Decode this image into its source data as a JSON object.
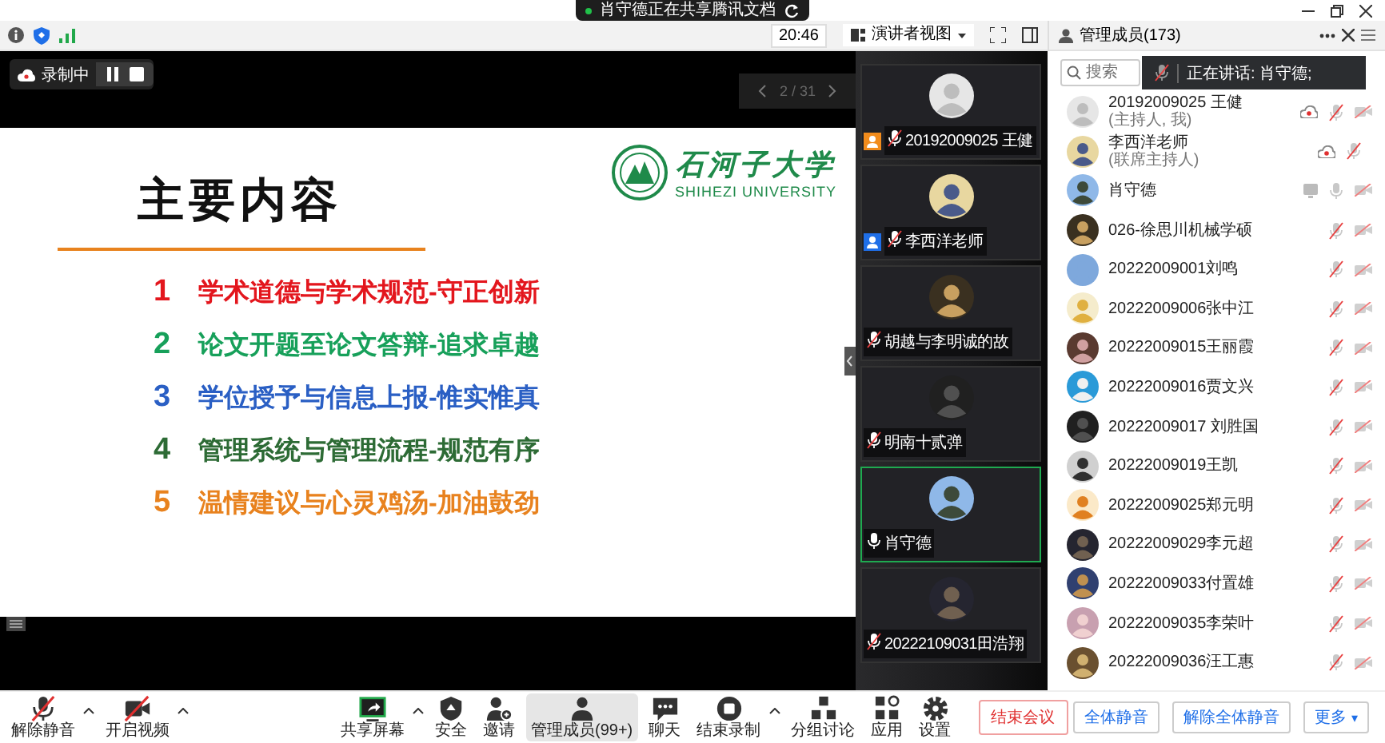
{
  "share_banner": {
    "text": "肖守德正在共享腾讯文档"
  },
  "toolbar": {
    "time": "20:46",
    "view": "演讲者视图",
    "members_title": "管理成员(173)"
  },
  "recording": {
    "label": "录制中"
  },
  "slide": {
    "page": "2 / 31",
    "title": "主要内容",
    "logo_cn": "石河子大学",
    "logo_en": "SHIHEZI UNIVERSITY",
    "items": [
      {
        "number": "1",
        "text": "学术道德与学术规范-守正创新",
        "color": "#e3161d"
      },
      {
        "number": "2",
        "text": "论文开题至论文答辩-追求卓越",
        "color": "#17a05a"
      },
      {
        "number": "3",
        "text": "学位授予与信息上报-惟实惟真",
        "color": "#2a5fc4"
      },
      {
        "number": "4",
        "text": "管理系统与管理流程-规范有序",
        "color": "#2d6b35"
      },
      {
        "number": "5",
        "text": "温情建议与心灵鸡汤-加油鼓劲",
        "color": "#e8821e"
      }
    ]
  },
  "video_tiles": [
    {
      "name": "20192009025 王健",
      "kind": "host",
      "mic_muted": true,
      "speaking": false
    },
    {
      "name": "李西洋老师",
      "kind": "cohost",
      "mic_muted": true,
      "speaking": false
    },
    {
      "name": "胡越与李明诚的故",
      "kind": "participant",
      "mic_muted": true,
      "speaking": false
    },
    {
      "name": "明南十贰弹",
      "kind": "participant",
      "mic_muted": true,
      "speaking": false
    },
    {
      "name": "肖守德",
      "kind": "participant",
      "mic_muted": false,
      "speaking": true
    },
    {
      "name": "20222109031田浩翔",
      "kind": "participant",
      "mic_muted": true,
      "speaking": false
    }
  ],
  "members": {
    "search_placeholder": "搜索",
    "speaking_banner": "正在讲话: 肖守德;",
    "participants": [
      {
        "name": "20192009025 王健",
        "role": "(主持人, 我)",
        "recording": true,
        "sharing": false,
        "mic_muted": true,
        "camera": true
      },
      {
        "name": "李西洋老师",
        "role": "(联席主持人)",
        "recording": true,
        "sharing": false,
        "mic_muted": true,
        "camera": false
      },
      {
        "name": "肖守德",
        "recording": false,
        "sharing": true,
        "mic_muted": false,
        "camera": true
      },
      {
        "name": "026-徐思川机械学硕",
        "recording": false,
        "sharing": false,
        "mic_muted": true,
        "camera": true
      },
      {
        "name": "20222009001刘鸣",
        "recording": false,
        "sharing": false,
        "mic_muted": true,
        "camera": true
      },
      {
        "name": "20222009006张中江",
        "recording": false,
        "sharing": false,
        "mic_muted": true,
        "camera": true
      },
      {
        "name": "20222009015王丽霞",
        "recording": false,
        "sharing": false,
        "mic_muted": true,
        "camera": true
      },
      {
        "name": "20222009016贾文兴",
        "recording": false,
        "sharing": false,
        "mic_muted": true,
        "camera": true
      },
      {
        "name": "20222009017 刘胜国",
        "recording": false,
        "sharing": false,
        "mic_muted": true,
        "camera": true
      },
      {
        "name": "20222009019王凯",
        "recording": false,
        "sharing": false,
        "mic_muted": true,
        "camera": true
      },
      {
        "name": "20222009025郑元明",
        "recording": false,
        "sharing": false,
        "mic_muted": true,
        "camera": true
      },
      {
        "name": "20222009029李元超",
        "recording": false,
        "sharing": false,
        "mic_muted": true,
        "camera": true
      },
      {
        "name": "20222009033付置雄",
        "recording": false,
        "sharing": false,
        "mic_muted": true,
        "camera": true
      },
      {
        "name": "20222009035李荣叶",
        "recording": false,
        "sharing": false,
        "mic_muted": true,
        "camera": true
      },
      {
        "name": "20222009036汪工惠",
        "recording": false,
        "sharing": false,
        "mic_muted": true,
        "camera": true
      }
    ],
    "buttons": [
      "全体静音",
      "解除全体静音",
      "更多"
    ],
    "more_caret": "▾"
  },
  "controls": [
    {
      "label": "解除静音",
      "caret": true,
      "selected": false
    },
    {
      "label": "开启视频",
      "caret": true,
      "selected": false
    },
    {
      "label": "共享屏幕",
      "caret": true,
      "selected": false
    },
    {
      "label": "安全",
      "caret": false,
      "selected": false
    },
    {
      "label": "邀请",
      "caret": false,
      "selected": false
    },
    {
      "label": "管理成员(99+)",
      "caret": false,
      "selected": true
    },
    {
      "label": "聊天",
      "caret": false,
      "selected": false
    },
    {
      "label": "结束录制",
      "caret": true,
      "selected": false
    },
    {
      "label": "分组讨论",
      "caret": false,
      "selected": false
    },
    {
      "label": "应用",
      "caret": false,
      "selected": false
    },
    {
      "label": "设置",
      "caret": false,
      "selected": false
    }
  ],
  "end_button": "结束会议"
}
